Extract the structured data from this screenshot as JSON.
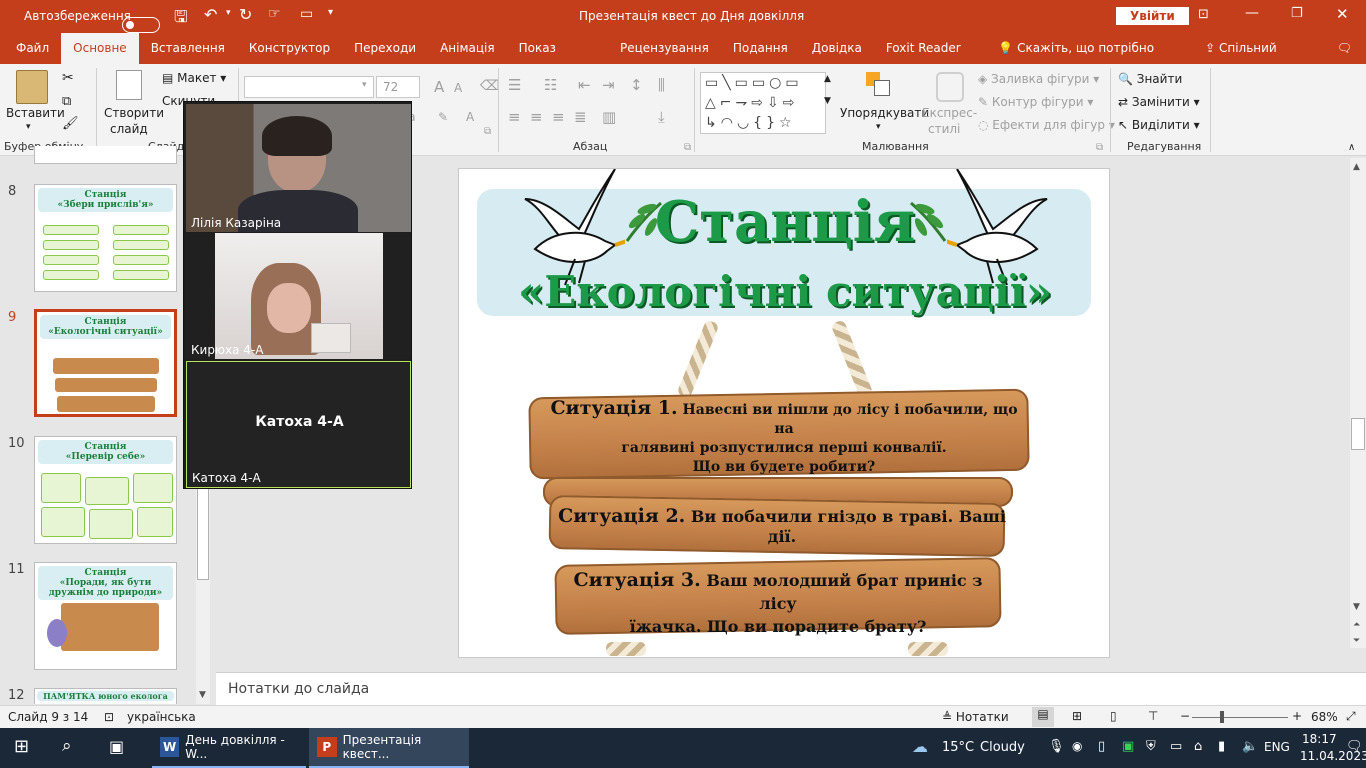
{
  "titlebar": {
    "autosave_label": "Автозбереження",
    "doc_title": "Презентація квест до Дня довкілля",
    "signin": "Увійти"
  },
  "tabs": [
    "Файл",
    "Основне",
    "Вставлення",
    "Конструктор",
    "Переходи",
    "Анімація",
    "Показ слайдів",
    "Рецензування",
    "Подання",
    "Довідка",
    "Foxit Reader PDF"
  ],
  "active_tab": "Основне",
  "tell_me": "Скажіть, що потрібно зробити",
  "share": "Спільний доступ",
  "ribbon": {
    "paste": "Вставити",
    "clipboard": "Буфер обміну",
    "new_slide_1": "Створити",
    "new_slide_2": "слайд",
    "layout": "Макет",
    "reset": "Скинути",
    "slides_group": "Слайди",
    "font_size": "72",
    "paragraph": "Абзац",
    "arrange": "Упорядкувати",
    "quick_styles_1": "Експрес-",
    "quick_styles_2": "стилі",
    "shape_fill": "Заливка фігури",
    "shape_outline": "Контур фігури",
    "shape_effects": "Ефекти для фігур",
    "drawing": "Малювання",
    "find": "Знайти",
    "replace": "Замінити",
    "select": "Виділити",
    "editing": "Редагування"
  },
  "thumbs": [
    {
      "num": "8",
      "title1": "Станція",
      "title2": "«Збери прислів'я»"
    },
    {
      "num": "9",
      "title1": "Станція",
      "title2": "«Екологічні ситуації»"
    },
    {
      "num": "10",
      "title1": "Станція",
      "title2": "«Перевір себе»"
    },
    {
      "num": "11",
      "title1": "Станція",
      "title2": "«Поради, як бути дружнім до природи»"
    },
    {
      "num": "12",
      "title1": "ПАМ'ЯТКА юного еколога"
    }
  ],
  "slide": {
    "title1": "Станція",
    "title2": "«Екологічні ситуації»",
    "s1_head": "Ситуація 1.",
    "s1_body_a": "Навесні ви пішли до лісу і побачили, що на",
    "s1_body_b": "галявині розпустилися перші конвалії.",
    "s1_body_c": "Що ви будете робити?",
    "s2_head": "Ситуація 2.",
    "s2_body": "Ви побачили гніздо в траві. Ваші дії.",
    "s3_head": "Ситуація 3.",
    "s3_body_a": "Ваш молодший брат приніс з лісу",
    "s3_body_b": "їжачка. Що ви порадите брату?"
  },
  "video": [
    {
      "name": "Лілія Казаріна"
    },
    {
      "name": "Кирюха 4-А"
    },
    {
      "name": "Катоха 4-А",
      "center_name": "Катоха 4-А"
    }
  ],
  "notes_placeholder": "Нотатки до слайда",
  "status": {
    "slide_of": "Слайд 9 з 14",
    "language": "українська",
    "notes": "Нотатки",
    "zoom": "68%"
  },
  "taskbar": {
    "word": "День довкілля - W...",
    "ppt": "Презентація квест...",
    "temp": "15°C",
    "weather": "Cloudy",
    "lang": "ENG",
    "time": "18:17",
    "date": "11.04.2023"
  },
  "colors": {
    "accent": "#c43e1c",
    "title_green": "#1c9a48"
  }
}
